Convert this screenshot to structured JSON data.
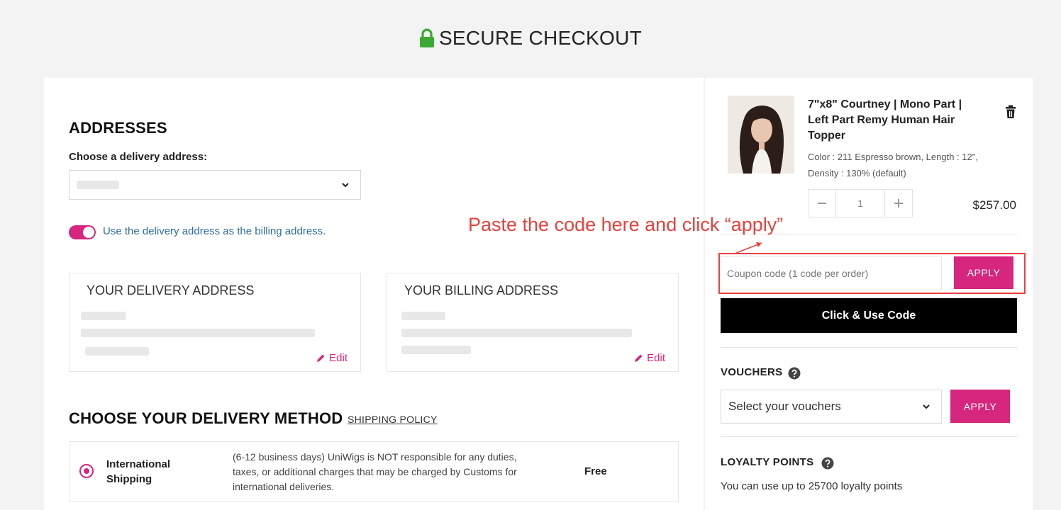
{
  "header": {
    "title": "SECURE CHECKOUT"
  },
  "addresses": {
    "title": "ADDRESSES",
    "choose_label": "Choose a delivery address:",
    "billing_toggle_label": "Use the delivery address as the billing address.",
    "delivery_card": {
      "title": "YOUR DELIVERY ADDRESS",
      "edit": "Edit"
    },
    "billing_card": {
      "title": "YOUR BILLING ADDRESS",
      "edit": "Edit"
    }
  },
  "delivery_method": {
    "title": "CHOOSE YOUR DELIVERY METHOD",
    "policy_link": "SHIPPING POLICY",
    "options": [
      {
        "name_line1": "International",
        "name_line2": "Shipping",
        "desc_line1": "(6-12 business days) UniWigs is NOT responsible for any duties,",
        "desc_line2": "taxes, or additional charges that may be charged by Customs for",
        "desc_line3": "international deliveries.",
        "price": "Free"
      }
    ]
  },
  "cart": {
    "product": {
      "name_line1": "7\"x8\" Courtney | Mono Part |",
      "name_line2": "Left Part Remy Human Hair",
      "name_line3": "Topper",
      "options_line1": "Color : 211 Espresso brown, Length : 12\",",
      "options_line2": "Density : 130% (default)",
      "quantity": "1",
      "price": "$257.00"
    },
    "annotation": "Paste the code here and click “apply”",
    "coupon": {
      "placeholder": "Coupon code (1 code per order)",
      "apply": "APPLY"
    },
    "click_use_code": "Click & Use Code",
    "vouchers": {
      "label": "VOUCHERS",
      "select_value": "Select your vouchers",
      "apply": "APPLY"
    },
    "loyalty": {
      "label": "LOYALTY POINTS",
      "text": "You can use up to 25700 loyalty points"
    }
  },
  "colors": {
    "accent": "#d6267d",
    "annotation": "#e8413c",
    "lock": "#3aaa35"
  }
}
